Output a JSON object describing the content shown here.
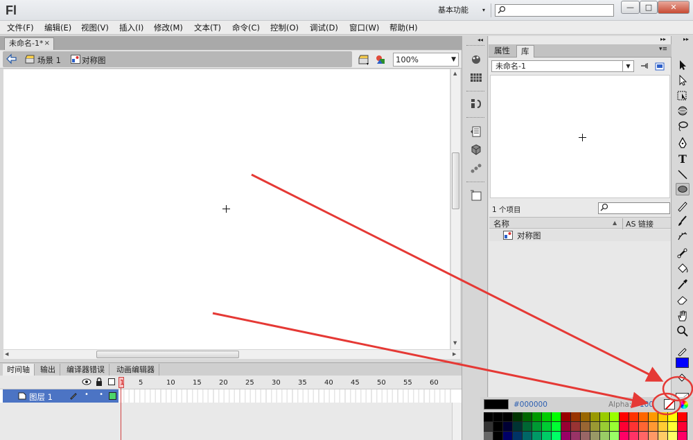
{
  "app": {
    "logo": "Fl",
    "workspace": "基本功能",
    "workspace_arrow": "▾"
  },
  "window_controls": {
    "minimize": "—",
    "maximize": "□",
    "close": "✕"
  },
  "menu": [
    "文件(F)",
    "编辑(E)",
    "视图(V)",
    "插入(I)",
    "修改(M)",
    "文本(T)",
    "命令(C)",
    "控制(O)",
    "调试(D)",
    "窗口(W)",
    "帮助(H)"
  ],
  "document": {
    "tab_title": "未命名-1*",
    "tab_close": "×",
    "breadcrumb": {
      "scene": "场景 1",
      "symbol": "对称图"
    },
    "zoom": "100%"
  },
  "timeline": {
    "tabs": [
      "时间轴",
      "输出",
      "编译器错误",
      "动画编辑器"
    ],
    "ruler": [
      "1",
      "5",
      "10",
      "15",
      "20",
      "25",
      "30",
      "35",
      "40",
      "45",
      "50",
      "55",
      "60"
    ],
    "layer_name": "图层 1",
    "layer_dots": "• •"
  },
  "library": {
    "tabs": [
      "属性",
      "库"
    ],
    "document_select": "未命名-1",
    "item_count": "1 个项目",
    "col_name": "名称",
    "col_linkage": "AS 链接",
    "items": [
      {
        "name": "对称图",
        "icon": "graphic-symbol-icon"
      }
    ]
  },
  "swatches": {
    "hex": "#000000",
    "alpha_label": "Alpha:",
    "alpha_value": "100"
  },
  "colors": {
    "fill": "#0000ff",
    "stroke": "#ffffff",
    "current_swatch": "#000000",
    "selection": "#4c74c4",
    "annotation": "#e53935"
  },
  "icons": {
    "search": "search-icon",
    "back": "back-arrow-icon",
    "scene": "scene-clapper-icon",
    "symbol": "graphic-symbol-icon",
    "edit_scene": "edit-scene-icon",
    "edit_symbol": "edit-symbol-icon"
  },
  "panel_collapse": {
    "left": "◂◂",
    "right": "▸▸"
  }
}
